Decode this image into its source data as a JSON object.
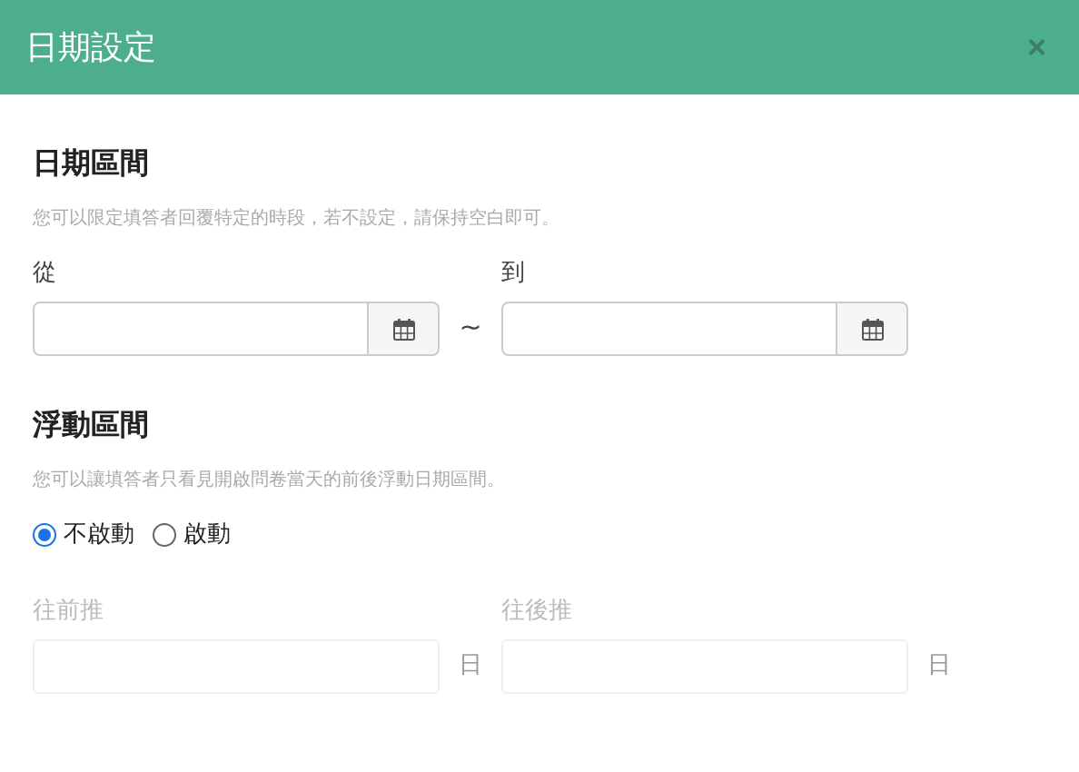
{
  "dialog": {
    "title": "日期設定",
    "close": "×"
  },
  "date_range": {
    "title": "日期區間",
    "description": "您可以限定填答者回覆特定的時段，若不設定，請保持空白即可。",
    "from": {
      "label": "從"
    },
    "separator": "~",
    "to": {
      "label": "到"
    }
  },
  "floating_range": {
    "title": "浮動區間",
    "description": "您可以讓填答者只看見開啟問卷當天的前後浮動日期區間。",
    "options": [
      {
        "label": "不啟動",
        "selected": true
      },
      {
        "label": "啟動",
        "selected": false
      }
    ],
    "fields": [
      {
        "label": "往前推",
        "unit": "日",
        "disabled": true
      },
      {
        "label": "往後推",
        "unit": "日",
        "disabled": true
      }
    ]
  }
}
